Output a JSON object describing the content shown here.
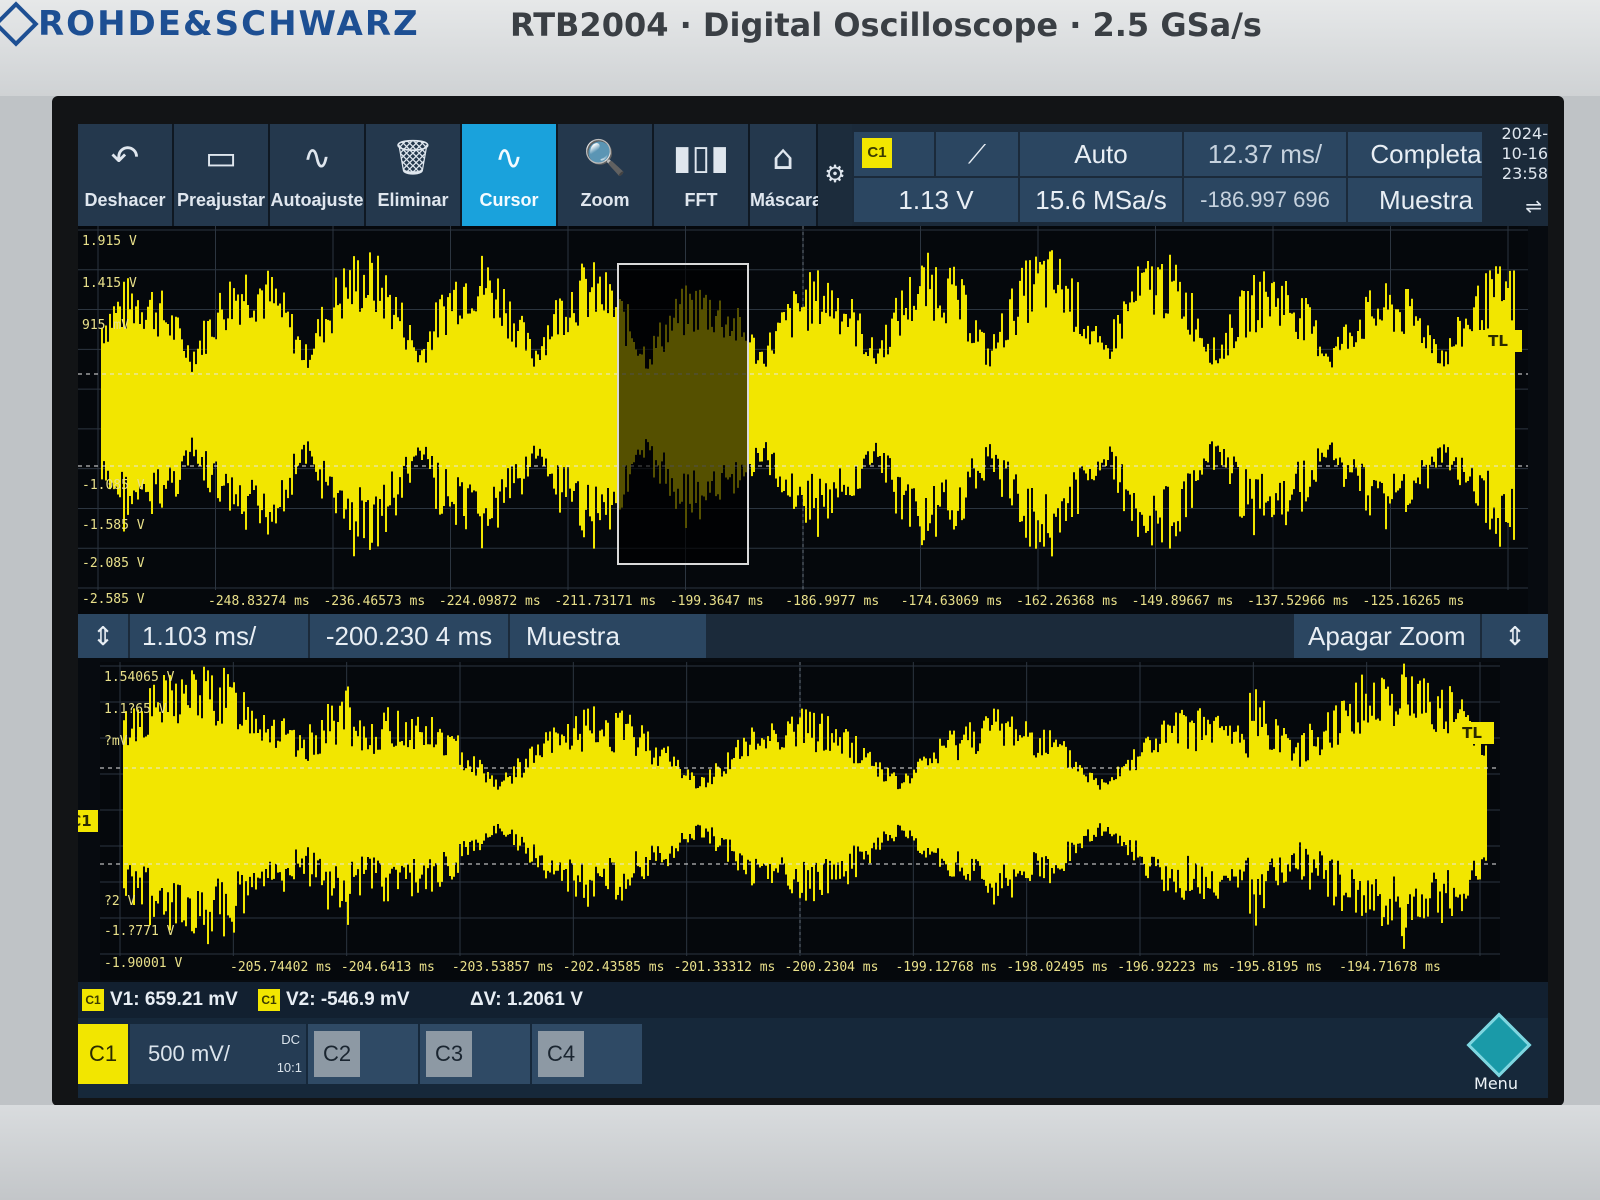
{
  "header": {
    "brand": "ROHDE&SCHWARZ",
    "model": "RTB2004 · Digital Oscilloscope · 2.5 GSa/s"
  },
  "toolbar": {
    "items": [
      {
        "label": "Deshacer",
        "icon": "undo-icon"
      },
      {
        "label": "Preajustar",
        "icon": "preset-icon"
      },
      {
        "label": "Autoajuste",
        "icon": "autoset-icon"
      },
      {
        "label": "Eliminar",
        "icon": "trash-icon"
      },
      {
        "label": "Cursor",
        "icon": "cursor-wave-icon"
      },
      {
        "label": "Zoom",
        "icon": "zoom-icon"
      },
      {
        "label": "FFT",
        "icon": "fft-icon"
      },
      {
        "label": "Máscara",
        "icon": "mask-icon"
      }
    ],
    "active": "Cursor"
  },
  "trigger": {
    "channel": "C1",
    "slope": "rising",
    "level": "1.13 V",
    "mode": "Auto",
    "sample_rate": "15.6 MSa/s",
    "time_scale": "12.37 ms/",
    "time_position": "-186.997 696 ms",
    "acquisition": "Completa",
    "acq_mode": "Muestra",
    "date": "2024-10-16",
    "time": "23:58"
  },
  "main_plot": {
    "y_labels": [
      "1.915 V",
      "1.415 V",
      "915 mV",
      "-1.085 V",
      "-1.585 V",
      "-2.085 V",
      "-2.585 V"
    ],
    "x_labels": [
      "-248.83274 ms",
      "-236.46573 ms",
      "-224.09872 ms",
      "-211.73171 ms",
      "-199.3647 ms",
      "-186.9977 ms",
      "-174.63069 ms",
      "-162.26368 ms",
      "-149.89667 ms",
      "-137.52966 ms",
      "-125.16265 ms"
    ],
    "channel_marker": "C1",
    "trigger_marker": "TL",
    "cursor1": "1",
    "cursor2": "2"
  },
  "zoom_bar": {
    "scale": "1.103 ms/",
    "position": "-200.230 4 ms",
    "mode": "Muestra",
    "off_label": "Apagar Zoom",
    "close": "×"
  },
  "zoom_plot": {
    "y_labels": [
      "1.54065 V",
      "1.1?65 V",
      "?mV",
      "?2 V",
      "-1.?771 V",
      "-1.90001 V"
    ],
    "x_labels": [
      "-205.74402 ms",
      "-204.6413 ms",
      "-203.53857 ms",
      "-202.43585 ms",
      "-201.33312 ms",
      "-200.2304 ms",
      "-199.12768 ms",
      "-198.02495 ms",
      "-196.92223 ms",
      "-195.8195 ms",
      "-194.71678 ms"
    ],
    "channel_marker": "C1",
    "trigger_marker": "TL",
    "cursor1": "1",
    "cursor2": "2"
  },
  "cursors": {
    "v1": "V1: 659.21 mV",
    "v2": "V2: -546.9 mV",
    "dv": "ΔV: 1.2061 V",
    "tag": "C1"
  },
  "channels": {
    "c1": {
      "name": "C1",
      "scale": "500 mV/",
      "coupling": "DC",
      "probe": "10:1"
    },
    "c2": "C2",
    "c3": "C3",
    "c4": "C4",
    "menu": "Menu",
    "logo": "R&S"
  },
  "colors": {
    "signal": "#f2e600",
    "accent": "#1aa2dc",
    "panel": "#2b4661"
  }
}
